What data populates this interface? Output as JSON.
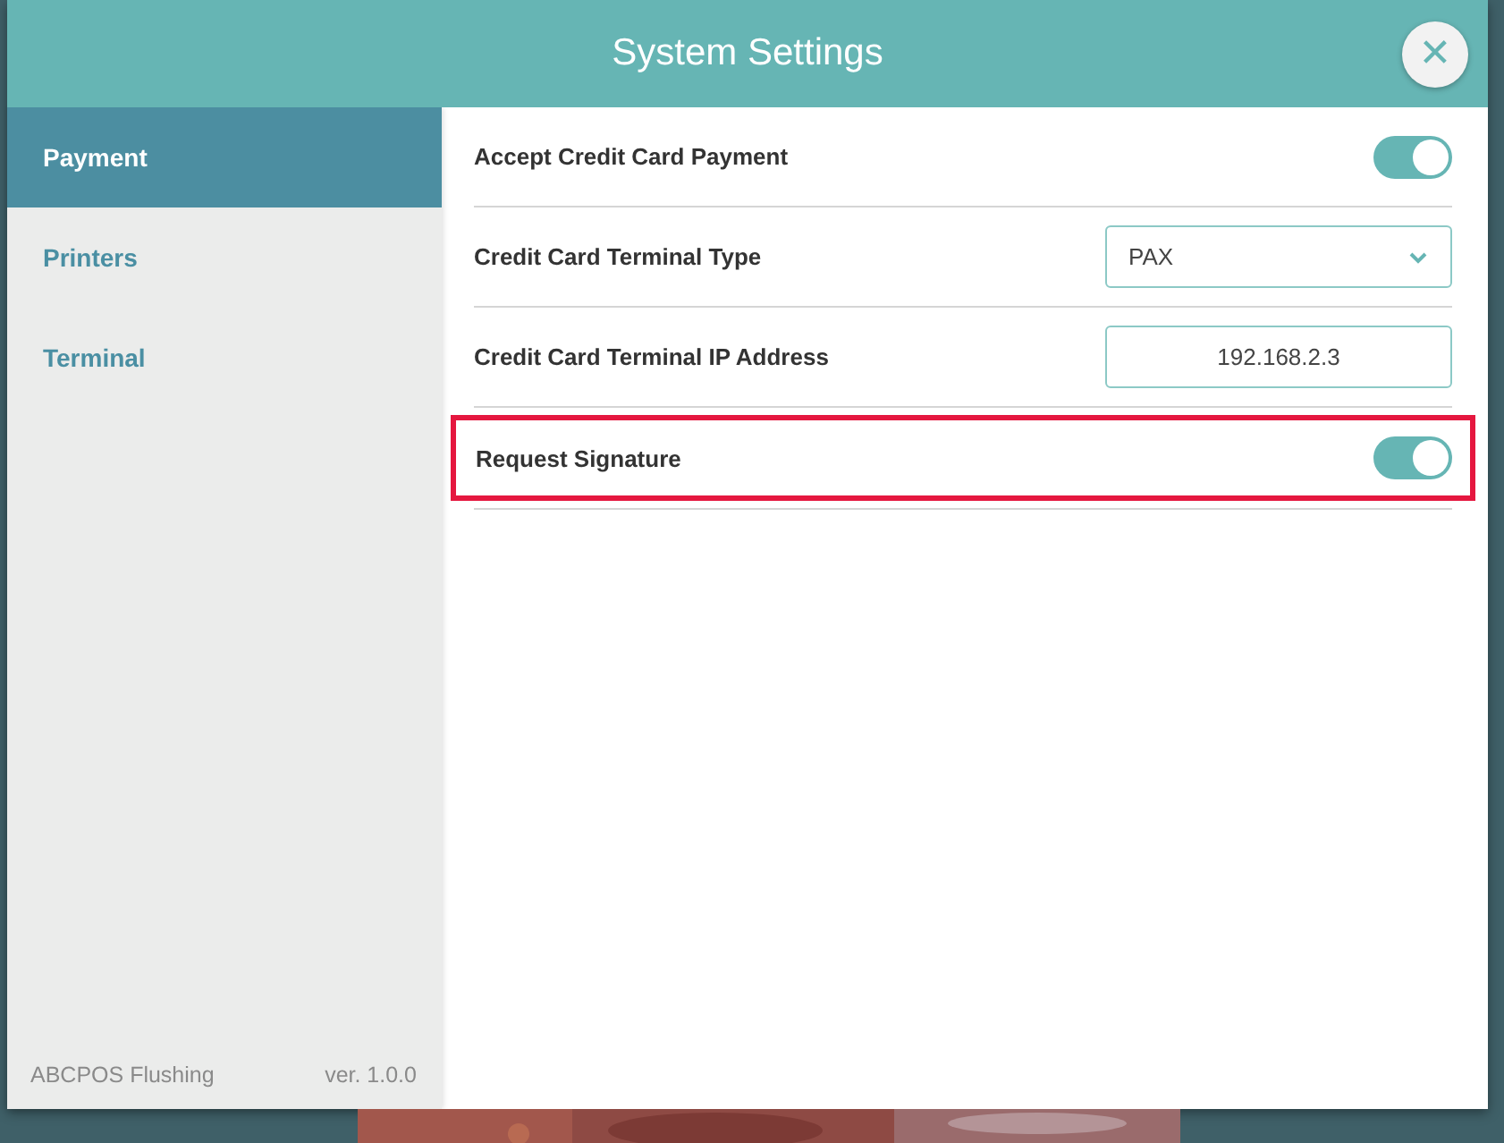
{
  "window": {
    "title": "System Settings",
    "close_button": "✕"
  },
  "sidebar": {
    "items": [
      {
        "label": "Payment",
        "selected": true
      },
      {
        "label": "Printers",
        "selected": false
      },
      {
        "label": "Terminal",
        "selected": false
      }
    ],
    "footer": {
      "store": "ABCPOS Flushing",
      "version": "ver. 1.0.0"
    }
  },
  "settings": [
    {
      "kind": "toggle",
      "label": "Accept Credit Card Payment",
      "on": true,
      "highlighted": false
    },
    {
      "kind": "select",
      "label": "Credit Card Terminal Type",
      "value": "PAX",
      "highlighted": false
    },
    {
      "kind": "text",
      "label": "Credit Card Terminal IP Address",
      "value": "192.168.2.3",
      "highlighted": false
    },
    {
      "kind": "toggle",
      "label": "Request Signature",
      "on": true,
      "highlighted": true
    }
  ]
}
